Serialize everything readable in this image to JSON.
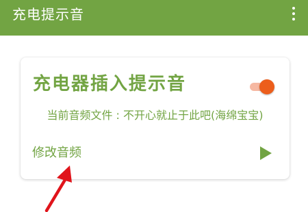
{
  "app_bar": {
    "title": "充电提示音",
    "menu_icon": "more-vert-icon"
  },
  "card": {
    "title": "充电器插入提示音",
    "toggle_on": true,
    "audio_file_text": "当前音频文件 : 不开心就止于此吧(海绵宝宝)",
    "modify_label": "修改音频",
    "play_icon": "play-icon"
  },
  "annotation": {
    "arrow_icon": "red-arrow-icon"
  },
  "colors": {
    "primary": "#72a443",
    "accent": "#ec5e1c",
    "accent_track": "#f6b8a2",
    "annotation": "#e0141b"
  }
}
